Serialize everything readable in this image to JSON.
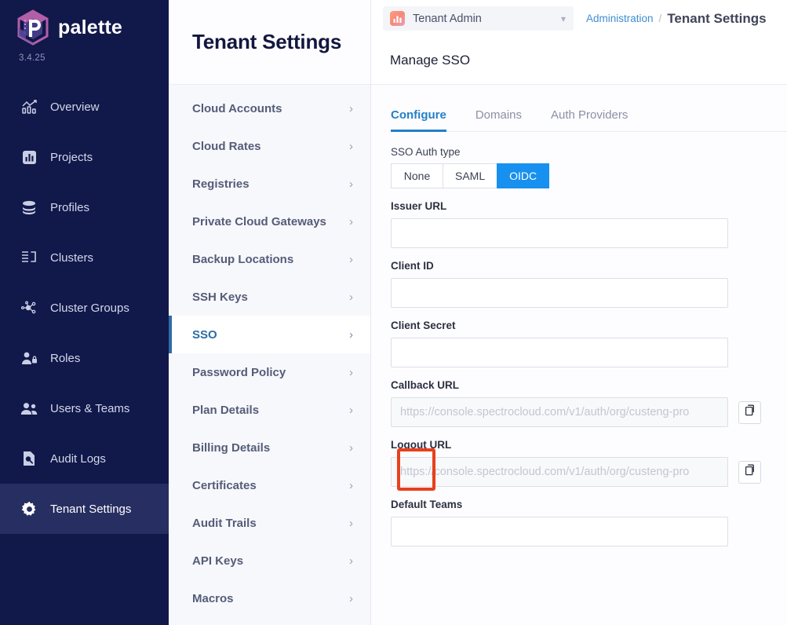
{
  "brand": {
    "name": "palette",
    "version": "3.4.25",
    "logo_icon": "palette-hexagon-logo"
  },
  "leftnav": {
    "items": [
      {
        "label": "Overview",
        "icon": "chart-overview-icon",
        "active": false
      },
      {
        "label": "Projects",
        "icon": "projects-bar-icon",
        "active": false
      },
      {
        "label": "Profiles",
        "icon": "profiles-stack-icon",
        "active": false
      },
      {
        "label": "Clusters",
        "icon": "clusters-list-icon",
        "active": false
      },
      {
        "label": "Cluster Groups",
        "icon": "cluster-groups-nodes-icon",
        "active": false
      },
      {
        "label": "Roles",
        "icon": "roles-user-lock-icon",
        "active": false
      },
      {
        "label": "Users & Teams",
        "icon": "users-teams-icon",
        "active": false
      },
      {
        "label": "Audit Logs",
        "icon": "audit-logs-icon",
        "active": false
      },
      {
        "label": "Tenant Settings",
        "icon": "gear-icon",
        "active": true
      }
    ]
  },
  "topbar": {
    "tenant_selector": {
      "label": "Tenant Admin",
      "icon": "tenant-admin-icon",
      "chevron": "chevron-down-icon"
    },
    "breadcrumb": {
      "parent": "Administration",
      "separator": "/",
      "current": "Tenant Settings"
    }
  },
  "settings_panel": {
    "title": "Tenant Settings",
    "items": [
      {
        "label": "Cloud Accounts",
        "active": false
      },
      {
        "label": "Cloud Rates",
        "active": false
      },
      {
        "label": "Registries",
        "active": false
      },
      {
        "label": "Private Cloud Gateways",
        "active": false
      },
      {
        "label": "Backup Locations",
        "active": false
      },
      {
        "label": "SSH Keys",
        "active": false
      },
      {
        "label": "SSO",
        "active": true
      },
      {
        "label": "Password Policy",
        "active": false
      },
      {
        "label": "Plan Details",
        "active": false
      },
      {
        "label": "Billing Details",
        "active": false
      },
      {
        "label": "Certificates",
        "active": false
      },
      {
        "label": "Audit Trails",
        "active": false
      },
      {
        "label": "API Keys",
        "active": false
      },
      {
        "label": "Macros",
        "active": false
      }
    ],
    "chevron_icon": "chevron-right-icon"
  },
  "main": {
    "title": "Manage SSO",
    "tabs": [
      {
        "label": "Configure",
        "active": true
      },
      {
        "label": "Domains",
        "active": false
      },
      {
        "label": "Auth Providers",
        "active": false
      }
    ],
    "sso_auth_type": {
      "label": "SSO Auth type",
      "options": [
        {
          "label": "None",
          "selected": false
        },
        {
          "label": "SAML",
          "selected": false
        },
        {
          "label": "OIDC",
          "selected": true
        }
      ]
    },
    "fields": [
      {
        "label": "Issuer URL",
        "value": "",
        "placeholder": "",
        "readonly": false,
        "copy": false,
        "highlight": false
      },
      {
        "label": "Client ID",
        "value": "",
        "placeholder": "",
        "readonly": false,
        "copy": false,
        "highlight": false
      },
      {
        "label": "Client Secret",
        "value": "",
        "placeholder": "",
        "readonly": false,
        "copy": false,
        "highlight": false
      },
      {
        "label": "Callback URL",
        "value": "",
        "placeholder": "https://console.spectrocloud.com/v1/auth/org/custeng-pro",
        "readonly": true,
        "copy": true,
        "highlight": false
      },
      {
        "label": "Logout URL",
        "value": "",
        "placeholder": "https://console.spectrocloud.com/v1/auth/org/custeng-pro",
        "readonly": true,
        "copy": true,
        "highlight": true
      },
      {
        "label": "Default Teams",
        "value": "",
        "placeholder": "",
        "readonly": false,
        "copy": false,
        "highlight": false
      }
    ],
    "copy_icon": "copy-icon"
  },
  "colors": {
    "nav_bg": "#11184a",
    "nav_active": "#272e61",
    "accent_blue": "#1890ef",
    "tab_active": "#2380c9",
    "sso_active": "#2b6ca6",
    "highlight_red": "#e8401c"
  }
}
